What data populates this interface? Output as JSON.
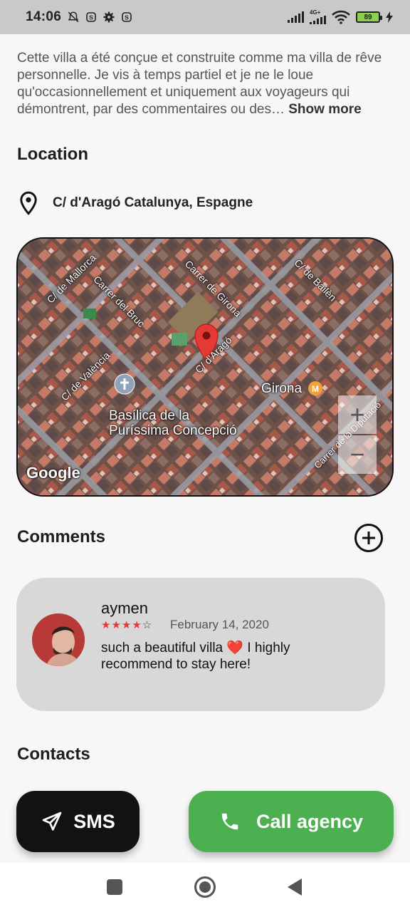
{
  "status_bar": {
    "time": "14:06",
    "network": "4G+",
    "battery": "89"
  },
  "description": {
    "text": "Cette villa a été conçue et construite comme ma villa de rêve personnelle. Je vis à temps partiel et je ne le loue qu'occasionnellement et uniquement aux voyageurs qui démontrent, par des commentaires ou des…",
    "show_more": "Show more"
  },
  "location": {
    "title": "Location",
    "address": "C/ d'Aragó Catalunya, Espagne"
  },
  "map": {
    "streets": [
      "C/ de Mallorca",
      "Carrer del Bruc",
      "Carrer de Girona",
      "C/ de Bailèn",
      "C/ d'Aragó",
      "C/ de València",
      "Carrer de la Diputació"
    ],
    "poi_name": "Basílica de la Puríssima Concepció",
    "metro_station": "Girona",
    "provider": "Google",
    "zoom_in": "+",
    "zoom_out": "−"
  },
  "comments": {
    "title": "Comments",
    "items": [
      {
        "user": "aymen",
        "rating": 4,
        "max_rating": 5,
        "date": "February 14, 2020",
        "text": "such a beautiful villa ❤️ I highly recommend to stay here!"
      }
    ]
  },
  "contacts": {
    "title": "Contacts"
  },
  "actions": {
    "sms_label": "SMS",
    "call_label": "Call agency"
  },
  "colors": {
    "call_green": "#4caf50",
    "sms_black": "#121212",
    "star_red": "#e53935",
    "map_pin_red": "#e53935"
  }
}
